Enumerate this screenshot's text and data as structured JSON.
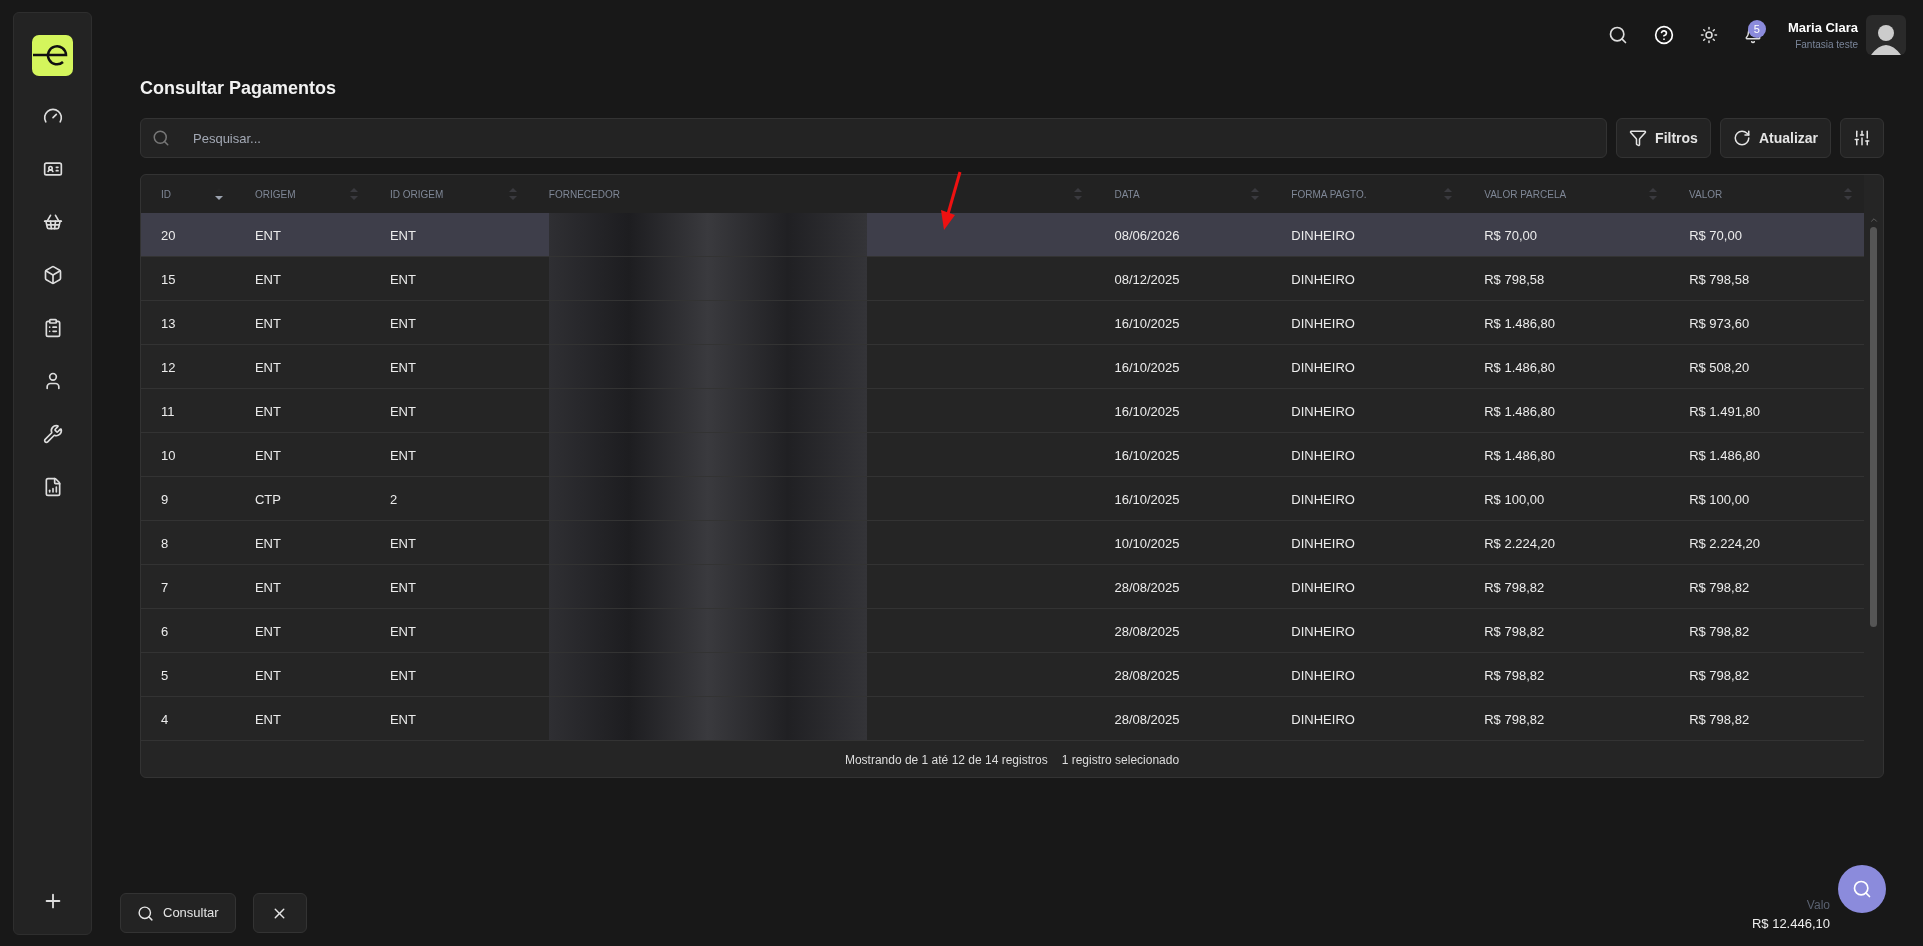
{
  "header": {
    "user_name": "Maria Clara",
    "user_company": "Fantasia teste",
    "notifications": "5"
  },
  "page": {
    "title": "Consultar Pagamentos"
  },
  "toolbar": {
    "search": {
      "placeholder": "Pesquisar..."
    },
    "buttons": [
      {
        "kind": "filter",
        "label": "Filtros"
      },
      {
        "kind": "refresh",
        "label": "Atualizar"
      },
      {
        "kind": "columns"
      }
    ]
  },
  "table": {
    "columns": [
      {
        "label": "ID",
        "sorted": true
      },
      {
        "label": "ORIGEM",
        "sorted": false
      },
      {
        "label": "ID ORIGEM",
        "sorted": false
      },
      {
        "label": "FORNECEDOR",
        "sorted": false
      },
      {
        "label": "DATA",
        "sorted": false
      },
      {
        "label": "FORMA PAGTO.",
        "sorted": false
      },
      {
        "label": "VALOR PARCELA",
        "sorted": false
      },
      {
        "label": "VALOR",
        "sorted": false
      }
    ],
    "rows": [
      {
        "selected": true,
        "cells": [
          "20",
          "ENT",
          "ENT",
          "",
          "08/06/2026",
          "DINHEIRO",
          "R$ 70,00",
          "R$ 70,00"
        ]
      },
      {
        "selected": false,
        "cells": [
          "15",
          "ENT",
          "ENT",
          "",
          "08/12/2025",
          "DINHEIRO",
          "R$ 798,58",
          "R$ 798,58"
        ]
      },
      {
        "selected": false,
        "cells": [
          "13",
          "ENT",
          "ENT",
          "",
          "16/10/2025",
          "DINHEIRO",
          "R$ 1.486,80",
          "R$ 973,60"
        ]
      },
      {
        "selected": false,
        "cells": [
          "12",
          "ENT",
          "ENT",
          "",
          "16/10/2025",
          "DINHEIRO",
          "R$ 1.486,80",
          "R$ 508,20"
        ]
      },
      {
        "selected": false,
        "cells": [
          "11",
          "ENT",
          "ENT",
          "",
          "16/10/2025",
          "DINHEIRO",
          "R$ 1.486,80",
          "R$ 1.491,80"
        ]
      },
      {
        "selected": false,
        "cells": [
          "10",
          "ENT",
          "ENT",
          "",
          "16/10/2025",
          "DINHEIRO",
          "R$ 1.486,80",
          "R$ 1.486,80"
        ]
      },
      {
        "selected": false,
        "cells": [
          "9",
          "CTP",
          "2",
          "",
          "16/10/2025",
          "DINHEIRO",
          "R$ 100,00",
          "R$ 100,00"
        ]
      },
      {
        "selected": false,
        "cells": [
          "8",
          "ENT",
          "ENT",
          "",
          "10/10/2025",
          "DINHEIRO",
          "R$ 2.224,20",
          "R$ 2.224,20"
        ]
      },
      {
        "selected": false,
        "cells": [
          "7",
          "ENT",
          "ENT",
          "",
          "28/08/2025",
          "DINHEIRO",
          "R$ 798,82",
          "R$ 798,82"
        ]
      },
      {
        "selected": false,
        "cells": [
          "6",
          "ENT",
          "ENT",
          "",
          "28/08/2025",
          "DINHEIRO",
          "R$ 798,82",
          "R$ 798,82"
        ]
      },
      {
        "selected": false,
        "cells": [
          "5",
          "ENT",
          "ENT",
          "",
          "28/08/2025",
          "DINHEIRO",
          "R$ 798,82",
          "R$ 798,82"
        ]
      },
      {
        "selected": false,
        "cells": [
          "4",
          "ENT",
          "ENT",
          "",
          "28/08/2025",
          "DINHEIRO",
          "R$ 798,82",
          "R$ 798,82"
        ]
      }
    ],
    "footer": {
      "range": "Mostrando de 1 até 12 de 14 registros",
      "selection": "1 registro selecionado"
    }
  },
  "actions": {
    "buttons": [
      {
        "kind": "search",
        "label": "Consultar"
      },
      {
        "kind": "clear"
      }
    ]
  },
  "total": {
    "label": "Valo",
    "value": "R$ 12.446,10"
  }
}
